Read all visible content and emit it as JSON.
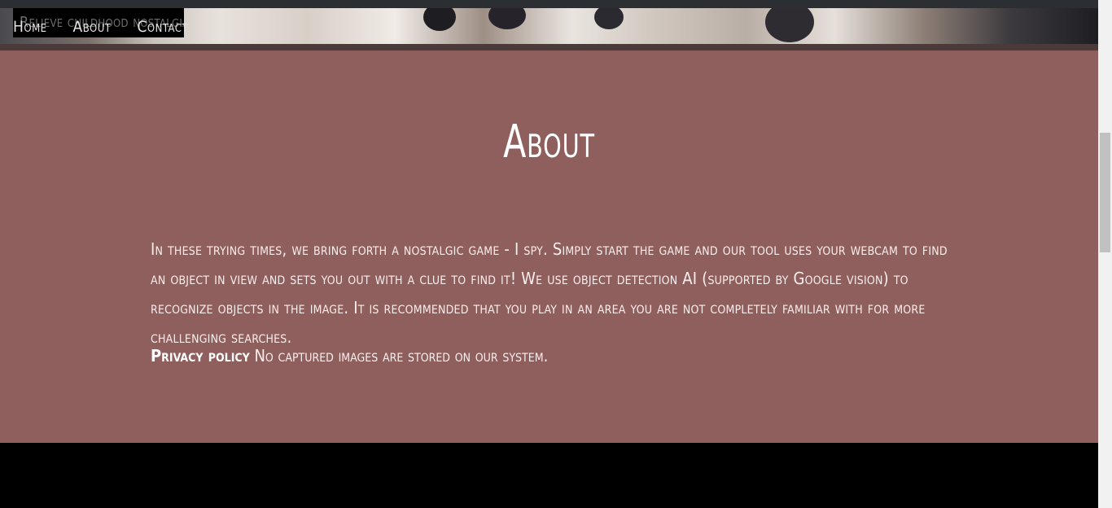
{
  "hero": {
    "tagline": "Relieve childhood nostalgia"
  },
  "nav": {
    "items": [
      "Home",
      "About",
      "Contact"
    ]
  },
  "about": {
    "title": "About",
    "body": "In these trying times, we bring forth a nostalgic game - I spy. Simply start the game and our tool uses your webcam to find an object in view and sets you out with a clue to find it! We use object detection AI (supported by Google vision) to recognize objects in the image. It is recommended that you play in an area you are not completely familiar with for more challenging searches.",
    "privacy_label": "Privacy policy",
    "privacy_text": "No captured images are stored on our system."
  },
  "colors": {
    "about_bg": "#8e5f5c",
    "footer_bg": "#000000"
  }
}
